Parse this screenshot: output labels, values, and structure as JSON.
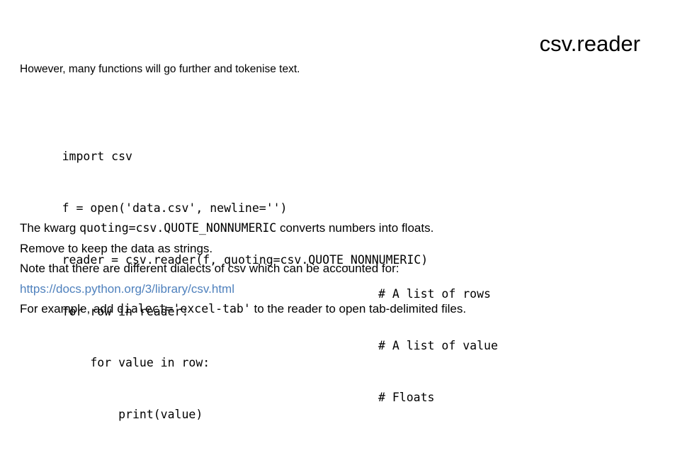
{
  "slide": {
    "title": "csv.reader",
    "intro": "However, many functions will go further and tokenise text.",
    "code": [
      {
        "code": "import csv",
        "comment": ""
      },
      {
        "code": "f = open('data.csv', newline='')",
        "comment": ""
      },
      {
        "code": "reader = csv.reader(f, quoting=csv.QUOTE_NONNUMERIC)",
        "comment": ""
      },
      {
        "code": "for row in reader:",
        "comment": "# A list of rows"
      },
      {
        "code": "    for value in row:",
        "comment": "# A list of value"
      },
      {
        "code": "        print(value)",
        "comment": "# Floats"
      }
    ],
    "body": {
      "line1_pre": "The kwarg ",
      "line1_code": "quoting=csv.QUOTE_NONNUMERIC",
      "line1_post": " converts numbers into floats.",
      "line2": "Remove to keep the data as strings.",
      "line3": "Note that there are different dialects of csv which can be accounted for:",
      "line4_link": "https://docs.python.org/3/library/csv.html",
      "line5_pre": "For example, add ",
      "line5_code": "dialect='excel-tab'",
      "line5_post": " to the reader to open tab-delimited files."
    },
    "colors": {
      "link": "#4f81bd",
      "text": "#000000",
      "background": "#ffffff"
    }
  }
}
